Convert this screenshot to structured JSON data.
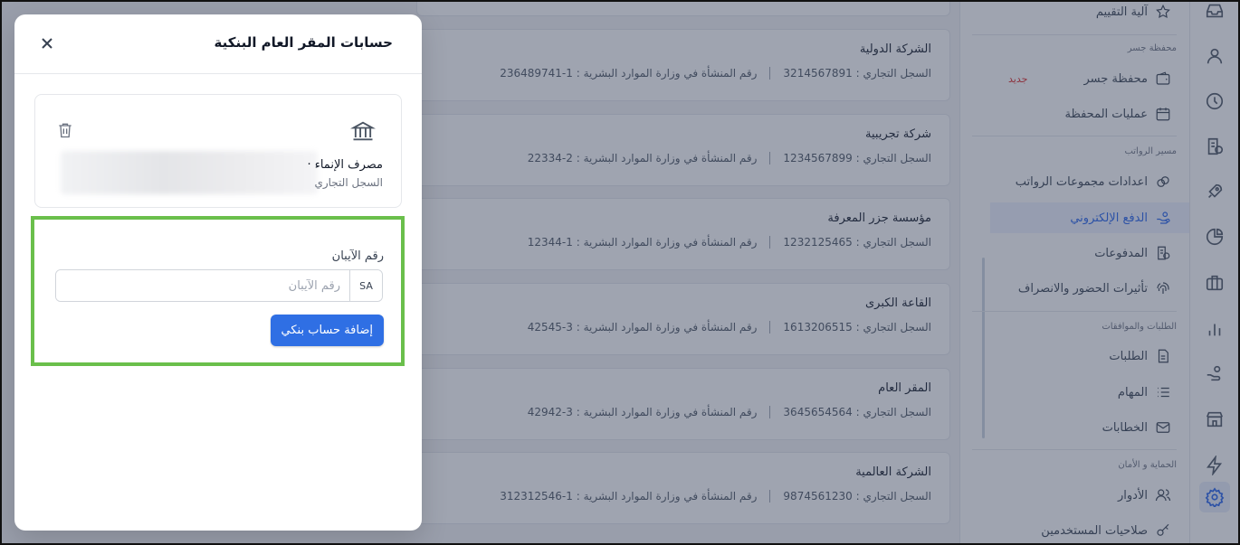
{
  "modal": {
    "title": "حسابات المقر العام البنكية",
    "bank_name": "مصرف الإنماء ·",
    "bank_sub": "السجل التجاري",
    "iban_label": "رقم الآيبان",
    "iban_prefix": "SA",
    "iban_placeholder": "رقم الآيبان",
    "iban_value": "",
    "add_button": "إضافة حساب بنكي"
  },
  "companies": [
    {
      "name": "",
      "cr": "",
      "mol": ""
    },
    {
      "name": "الشركة الدولية",
      "cr": "السجل التجاري : 3214567891",
      "mol": "رقم المنشأة في وزارة الموارد البشرية : 1-236489741"
    },
    {
      "name": "شركة تجريبية",
      "cr": "السجل التجاري : 1234567899",
      "mol": "رقم المنشأة في وزارة الموارد البشرية : 2-22334"
    },
    {
      "name": "مؤسسة جزر المعرفة",
      "cr": "السجل التجاري : 1232125465",
      "mol": "رقم المنشأة في وزارة الموارد البشرية : 1-12344"
    },
    {
      "name": "القاعة الكبرى",
      "cr": "السجل التجاري : 1613206515",
      "mol": "رقم المنشأة في وزارة الموارد البشرية : 3-42545"
    },
    {
      "name": "المقر العام",
      "cr": "السجل التجاري : 3645654564",
      "mol": "رقم المنشأة في وزارة الموارد البشرية : 3-42942"
    },
    {
      "name": "الشركة العالمية",
      "cr": "السجل التجاري : 9874561230",
      "mol": "رقم المنشأة في وزارة الموارد البشرية : 1-312312546"
    }
  ],
  "sidebar": {
    "item_rating": "آلية التقييم",
    "group_wallet": "محفظة جسر",
    "item_wallet": "محفظة جسر",
    "badge_new": "جديد",
    "item_wallet_ops": "عمليات المحفظة",
    "group_payroll": "مسير الرواتب",
    "item_payroll_groups": "اعدادات مجموعات الرواتب",
    "item_epay": "الدفع الإلكتروني",
    "item_payments": "المدفوعات",
    "item_attendance": "تأثيرات الحضور والانصراف",
    "group_requests": "الطلبات والموافقات",
    "item_requests": "الطلبات",
    "item_tasks": "المهام",
    "item_letters": "الخطابات",
    "group_security": "الحماية و الأمان",
    "item_roles": "الأدوار",
    "item_user_perms": "صلاحيات المستخدمين"
  },
  "colors": {
    "primary": "#2f6fe4",
    "highlight": "#6abf4b",
    "badge": "#dc2626"
  }
}
